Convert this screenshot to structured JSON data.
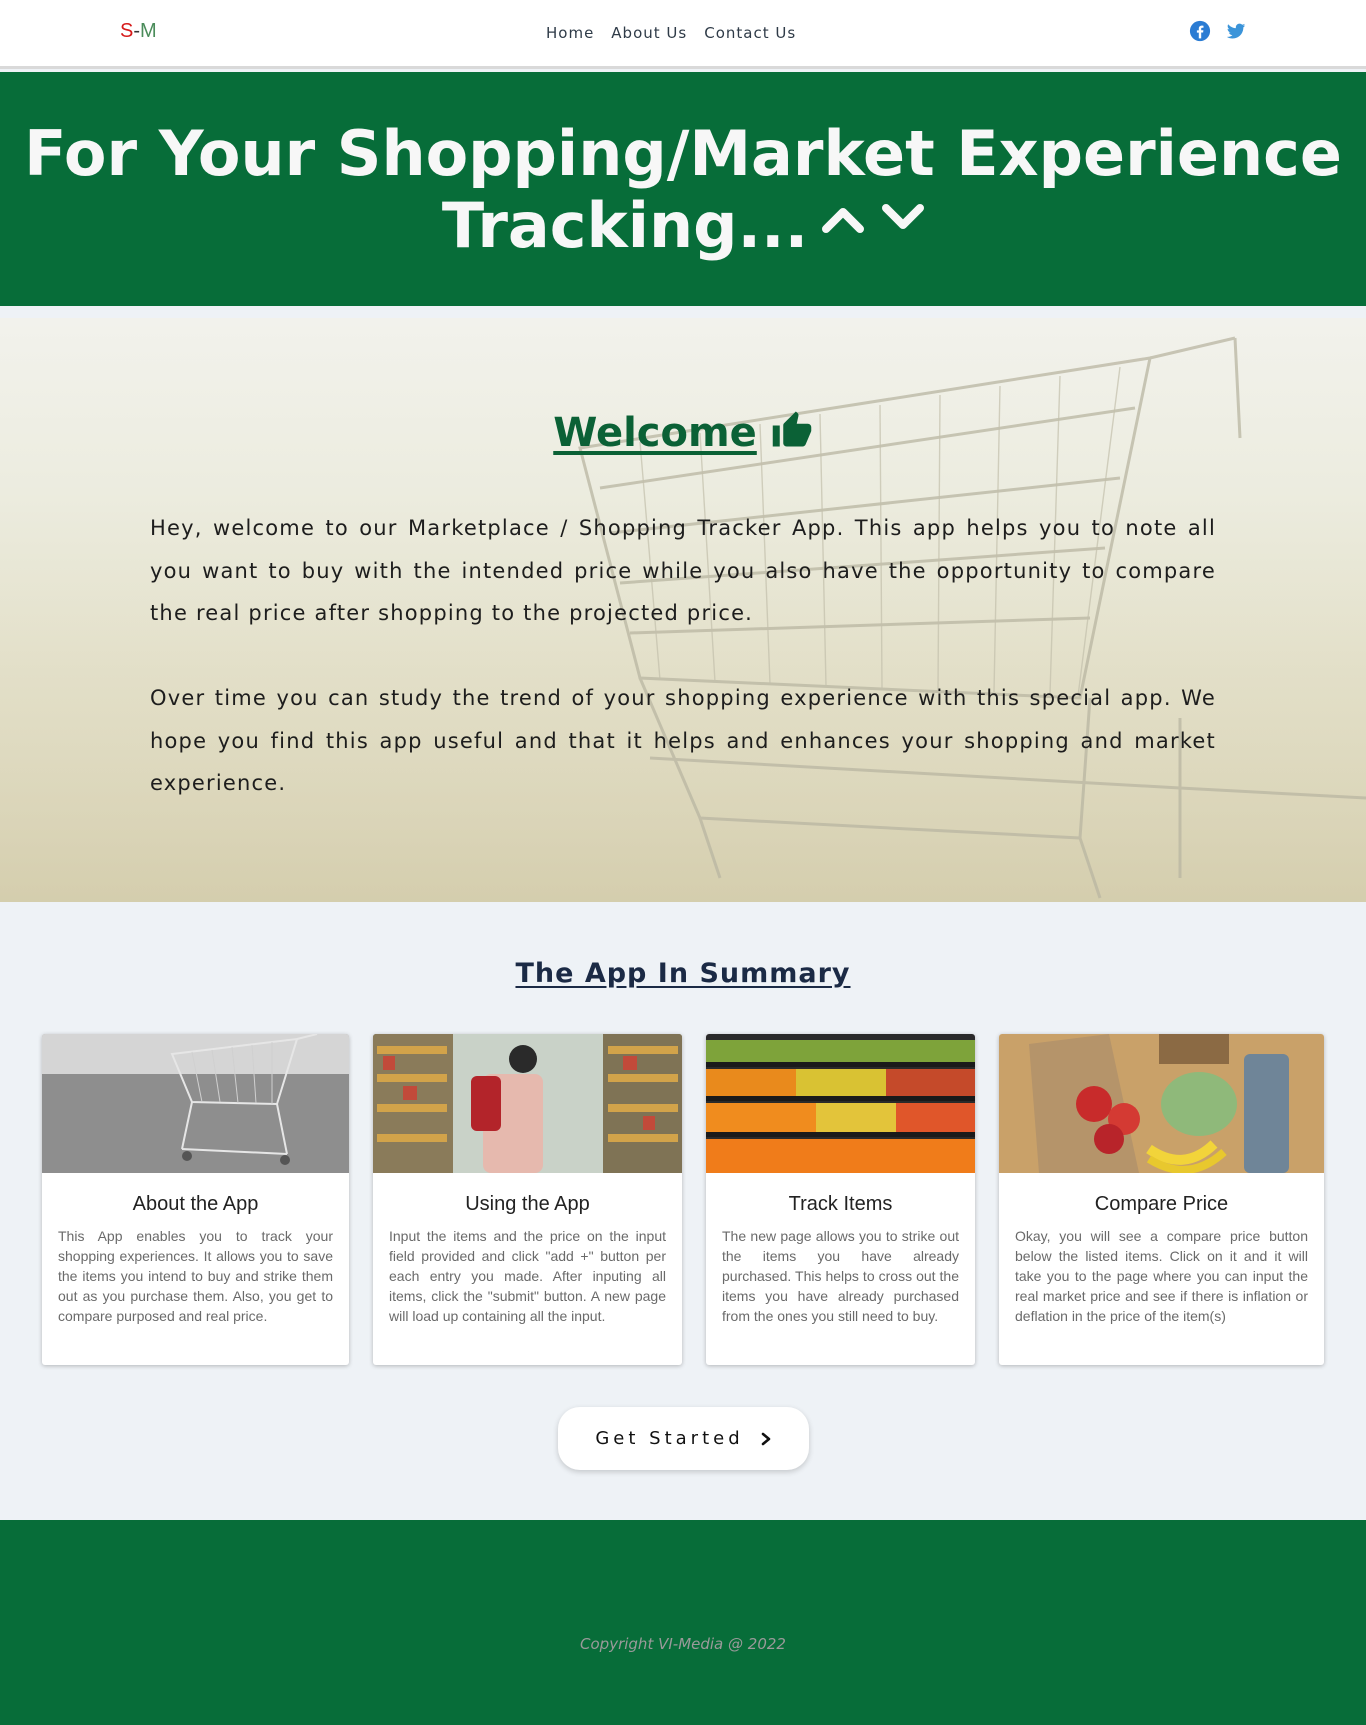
{
  "nav": {
    "logo_s": "S",
    "logo_dash": "-",
    "logo_m": "M",
    "links": [
      "Home",
      "About Us",
      "Contact Us"
    ]
  },
  "hero": {
    "title_line1": "For Your Shopping/Market Experience",
    "title_line2": "Tracking..."
  },
  "welcome": {
    "heading": "Welcome",
    "para1": "Hey, welcome to our Marketplace / Shopping Tracker App. This app helps you to note all you want to buy with the intended price while you also have the opportunity to compare the real price after shopping to the projected price.",
    "para2": "Over time you can study the trend of your shopping experience with this special app. We hope you find this app useful and that it helps and enhances your shopping and market experience."
  },
  "summary": {
    "title": "The App In Summary",
    "cards": [
      {
        "title": "About the App",
        "text": "This App enables you to track your shopping experiences. It allows you to save the items you intend to buy and strike them out as you purchase them. Also, you get to compare purposed and real price."
      },
      {
        "title": "Using the App",
        "text": "Input the items and the price on the input field provided and click \"add +\" button per each entry you made. After inputing all items, click the \"submit\" button. A new page will load up containing all the input."
      },
      {
        "title": "Track Items",
        "text": "The new page allows you to strike out the items you have already purchased. This helps to cross out the items you have already purchased from the ones you still need to buy."
      },
      {
        "title": "Compare Price",
        "text": "Okay, you will see a compare price button below the listed items. Click on it and it will take you to the page where you can input the real market price and see if there is inflation or deflation in the price of the item(s)"
      }
    ]
  },
  "cta": {
    "label": "Get Started"
  },
  "footer": {
    "copyright": "Copyright VI-Media @ 2022"
  },
  "colors": {
    "brand_green": "#076d39",
    "nav_text": "#2f3b48",
    "facebook": "#1877f2",
    "twitter": "#1da1f2"
  }
}
